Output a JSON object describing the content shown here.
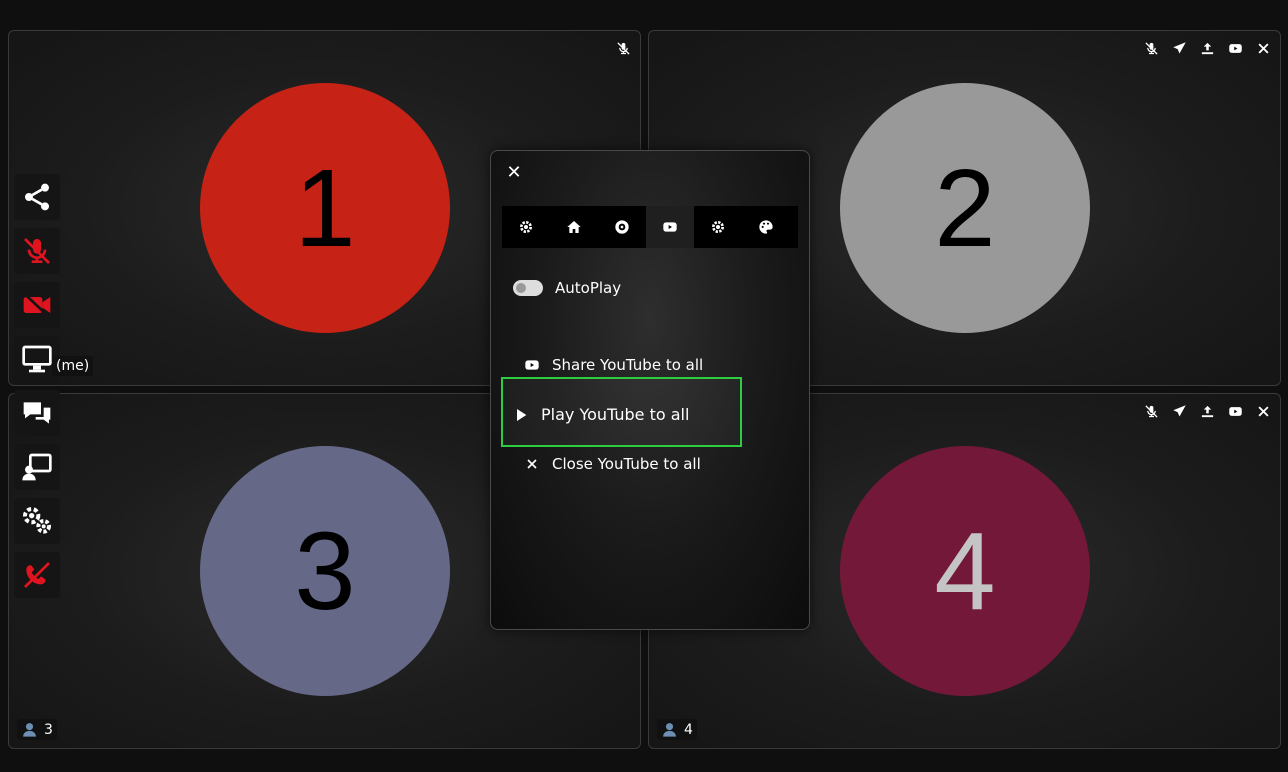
{
  "tiles": [
    {
      "number": "1",
      "color": "#c62216",
      "text_color": "#000000"
    },
    {
      "number": "2",
      "color": "#999999",
      "text_color": "#000000"
    },
    {
      "number": "3",
      "color": "#656987",
      "text_color": "#000000"
    },
    {
      "number": "4",
      "color": "#74183a",
      "text_color": "#c4c4c4"
    }
  ],
  "me_label": "(me)",
  "peer_labels": {
    "tile3": "3",
    "tile4": "4"
  },
  "modal": {
    "close_glyph": "✕",
    "tabs": [
      "gear-icon",
      "home-icon",
      "disc-icon",
      "youtube-icon",
      "gear-icon",
      "palette-icon"
    ],
    "active_tab": "youtube",
    "autoplay_label": "AutoPlay",
    "autoplay_on": false,
    "share_label": "Share YouTube to all",
    "play_label": "Play YouTube to all",
    "close_label": "Close YouTube to all"
  },
  "accent_colors": {
    "danger": "#e0141e",
    "highlight": "#2ecc40"
  }
}
